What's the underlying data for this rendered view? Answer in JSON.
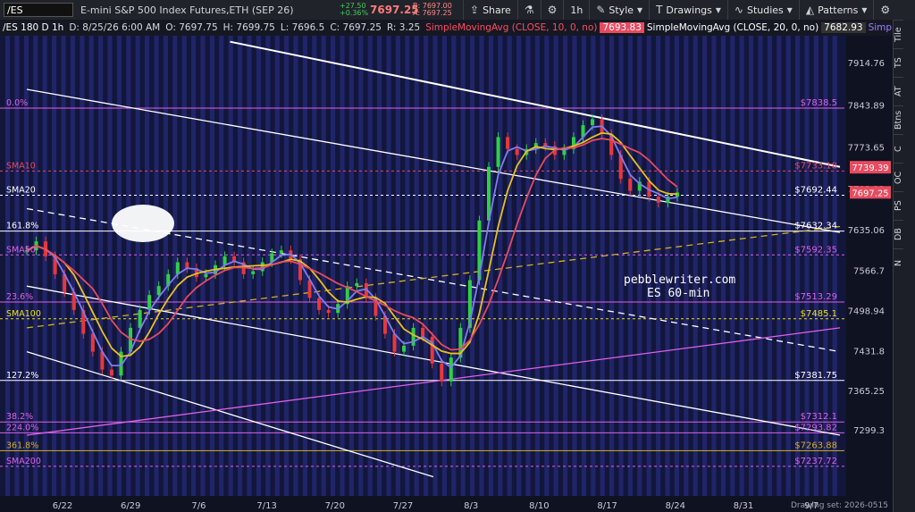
{
  "toolbar": {
    "symbol": "/ES",
    "description": "E-mini S&P 500 Index Futures,ETH (SEP 26)",
    "last": "7697.25",
    "net_change": "+27.50",
    "pct_change": "+0.36%",
    "bid": "B: 7697.00",
    "ask": "A: 7697.25",
    "share_label": "Share",
    "timeframe_label": "1h",
    "style_label": "Style",
    "drawings_label": "Drawings",
    "studies_label": "Studies",
    "patterns_label": "Patterns"
  },
  "status": {
    "aggregation": "/ES 180 D 1h",
    "date": "D: 8/25/26 6:00 AM",
    "open": "O: 7697.75",
    "high": "H: 7699.75",
    "low": "L: 7696.5",
    "close": "C: 7697.25",
    "range": "R: 3.25",
    "sma10_label": "SimpleMovingAvg (CLOSE, 10, 0, no)",
    "sma10_value": "7693.83",
    "sma20_label": "SimpleMovingAvg (CLOSE, 20, 0, no)",
    "sma20_value": "7682.93",
    "sma_next_label": "SimpleMovingAvg (C"
  },
  "right_tabs": [
    "Tile",
    "TS",
    "AT",
    "Btns",
    "C",
    "OC",
    "PS",
    "DB",
    "N"
  ],
  "drawing_set": "Drawing set: 2026-0515",
  "annotation": {
    "line1": "pebblewriter.com",
    "line2": "ES 60-min"
  },
  "colors": {
    "magenta": "#e060e8",
    "sma10": "#e84a5f",
    "sma20": "#7f7cf0",
    "sma50": "#e8c020",
    "white": "#ffffff",
    "yellow_dash": "#d4b020",
    "last_price": "#e84a5f"
  },
  "chart_data": {
    "type": "candlestick",
    "title": "",
    "xlabel": "",
    "ylabel": "",
    "x_ticks": [
      "6/22",
      "6/29",
      "7/6",
      "7/13",
      "7/20",
      "7/27",
      "8/3",
      "8/10",
      "8/17",
      "8/24",
      "8/31",
      "9/7"
    ],
    "y_ticks": [
      7914.76,
      7843.89,
      7773.65,
      7703.33,
      7635.06,
      7566.7,
      7498.94,
      7431.8,
      7365.25,
      7299.3
    ],
    "ylim": [
      7215,
      7960
    ],
    "x_range_days": [
      0,
      80
    ],
    "last_price": 7697.25,
    "sma10_last": 7739.39,
    "fib_levels": [
      {
        "label": "0.0%",
        "value": 7838.5,
        "price_label": "$7838.5",
        "color": "#e060e8"
      },
      {
        "label": "SMA10",
        "value": 7733.18,
        "price_label": "$7733.18",
        "color": "#e84a5f",
        "dashed": true
      },
      {
        "label": "SMA20",
        "value": 7692.44,
        "price_label": "$7692.44",
        "color": "#ffffff",
        "dashed": true
      },
      {
        "label": "161.8%",
        "value": 7632.34,
        "price_label": "$7632.34",
        "color": "#ffffff"
      },
      {
        "label": "SMA50",
        "value": 7592.35,
        "price_label": "$7592.35",
        "color": "#e060e8",
        "dashed": true
      },
      {
        "label": "23.6%",
        "value": 7513.29,
        "price_label": "$7513.29",
        "color": "#e060e8"
      },
      {
        "label": "SMA100",
        "value": 7485.1,
        "price_label": "$7485.1",
        "color": "#e8e020",
        "dashed": true
      },
      {
        "label": "127.2%",
        "value": 7381.75,
        "price_label": "$7381.75",
        "color": "#ffffff"
      },
      {
        "label": "38.2%",
        "value": 7312.1,
        "price_label": "$7312.1",
        "color": "#e060e8"
      },
      {
        "label": "224.0%",
        "value": 7293.82,
        "price_label": "$7293.82",
        "color": "#e060e8"
      },
      {
        "label": "361.8%",
        "value": 7263.88,
        "price_label": "$7263.88",
        "color": "#d4b020"
      },
      {
        "label": "SMA200",
        "value": 7237.72,
        "price_label": "$7237.72",
        "color": "#e060e8",
        "dashed": true
      }
    ],
    "trend_lines": [
      {
        "kind": "white_upper",
        "p1": [
          20,
          7950
        ],
        "p2": [
          80,
          7740
        ],
        "color": "#ffffff"
      },
      {
        "kind": "white_channel_top",
        "p1": [
          0,
          7870
        ],
        "p2": [
          80,
          7630
        ],
        "color": "#ffffff"
      },
      {
        "kind": "white_dashed",
        "p1": [
          0,
          7670
        ],
        "p2": [
          80,
          7430
        ],
        "color": "#ffffff",
        "dashed": true
      },
      {
        "kind": "white_channel_mid",
        "p1": [
          0,
          7540
        ],
        "p2": [
          80,
          7290
        ],
        "color": "#ffffff"
      },
      {
        "kind": "white_lower",
        "p1": [
          0,
          7430
        ],
        "p2": [
          40,
          7220
        ],
        "color": "#ffffff"
      },
      {
        "kind": "yellow_dashed",
        "p1": [
          0,
          7470
        ],
        "p2": [
          80,
          7640
        ],
        "color": "#d4b020",
        "dashed": true
      },
      {
        "kind": "magenta_rising",
        "p1": [
          0,
          7290
        ],
        "p2": [
          80,
          7470
        ],
        "color": "#e060e8"
      }
    ],
    "closes": [
      7600,
      7615,
      7590,
      7560,
      7530,
      7500,
      7460,
      7430,
      7400,
      7390,
      7430,
      7470,
      7500,
      7525,
      7540,
      7560,
      7580,
      7570,
      7555,
      7560,
      7575,
      7590,
      7580,
      7560,
      7565,
      7580,
      7595,
      7600,
      7585,
      7550,
      7520,
      7500,
      7495,
      7510,
      7540,
      7545,
      7520,
      7490,
      7460,
      7430,
      7440,
      7470,
      7455,
      7410,
      7380,
      7420,
      7470,
      7550,
      7650,
      7740,
      7790,
      7770,
      7760,
      7770,
      7780,
      7775,
      7760,
      7770,
      7790,
      7810,
      7820,
      7795,
      7760,
      7720,
      7700,
      7715,
      7690,
      7680,
      7690,
      7697
    ]
  }
}
